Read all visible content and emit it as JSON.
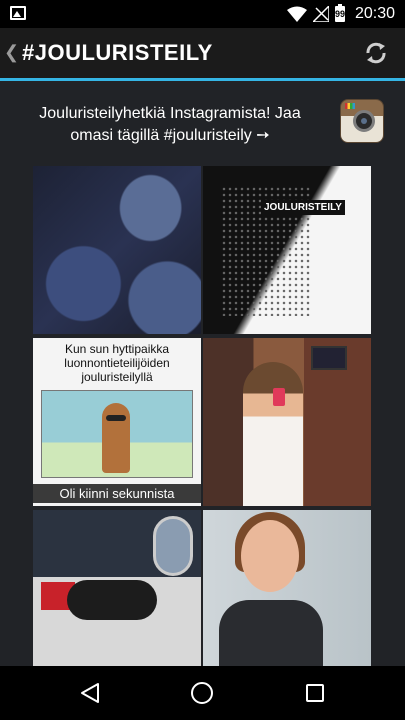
{
  "status_bar": {
    "time": "20:30",
    "battery": "99",
    "icons": [
      "gallery-icon",
      "wifi-icon",
      "no-signal-icon",
      "battery-icon"
    ]
  },
  "header": {
    "title": "#JOULURISTEILY",
    "back_icon": "chevron-left-icon",
    "refresh_icon": "refresh-icon",
    "accent_color": "#35b5e5"
  },
  "intro": {
    "text": "Jouluristeilyhetkiä Instagramista! Jaa omasi tägillä #jouluristeily ➙",
    "icon": "instagram-icon"
  },
  "photos": [
    {
      "name": "photo-1"
    },
    {
      "name": "photo-2",
      "logo_text": "JOULURISTEILY"
    },
    {
      "name": "photo-3",
      "top_text": "Kun sun hyttipaikka luonnontieteilijöiden jouluristeilyllä",
      "bottom_text": "Oli kiinni sekunnista"
    },
    {
      "name": "photo-4"
    },
    {
      "name": "photo-5"
    },
    {
      "name": "photo-6"
    }
  ],
  "nav_bar": {
    "icons": [
      "back-triangle-icon",
      "home-circle-icon",
      "recent-apps-icon"
    ]
  }
}
